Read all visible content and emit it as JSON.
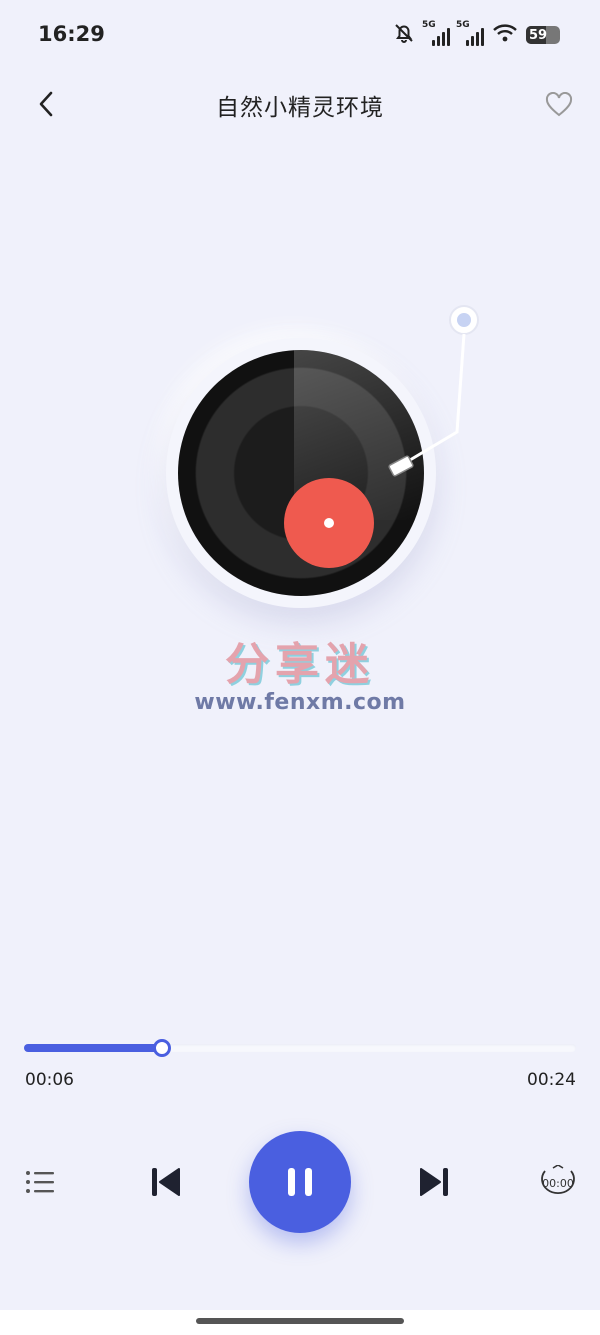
{
  "status_bar": {
    "time": "16:29",
    "net1": "5G",
    "net2": "5G",
    "battery": "59",
    "icons": [
      "mute-bell-icon",
      "signal-5g-icon",
      "signal-5g-icon",
      "wifi-icon",
      "battery-icon"
    ]
  },
  "header": {
    "title": "自然小精灵环境",
    "back_icon": "chevron-left-icon",
    "favorite_icon": "heart-outline-icon"
  },
  "player": {
    "artwork": "vinyl-record",
    "watermark_cn": "分享迷",
    "watermark_url": "www.fenxm.com",
    "progress_fraction": 0.25,
    "current_time": "00:06",
    "total_time": "00:24",
    "state": "playing"
  },
  "controls": {
    "playlist_icon": "playlist-icon",
    "prev_icon": "skip-previous-icon",
    "pause_icon": "pause-icon",
    "next_icon": "skip-next-icon",
    "timer_icon": "timer-icon",
    "timer_label": "00:00"
  },
  "colors": {
    "background": "#f0f1fb",
    "accent": "#4a5fe0",
    "record_label": "#ef5a4f"
  }
}
